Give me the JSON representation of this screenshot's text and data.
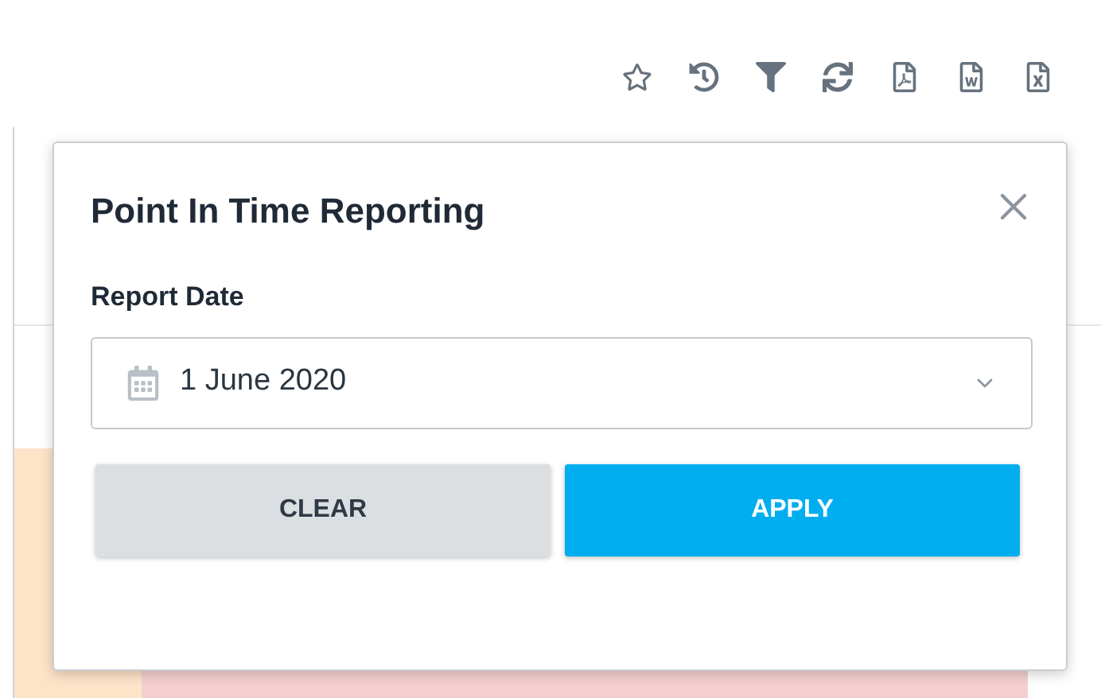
{
  "dialog": {
    "title": "Point In Time Reporting",
    "field": {
      "label": "Report Date",
      "value": "1 June 2020"
    },
    "buttons": [
      {
        "label": "CLEAR",
        "kind": "secondary"
      },
      {
        "label": "APPLY",
        "kind": "primary"
      }
    ]
  }
}
